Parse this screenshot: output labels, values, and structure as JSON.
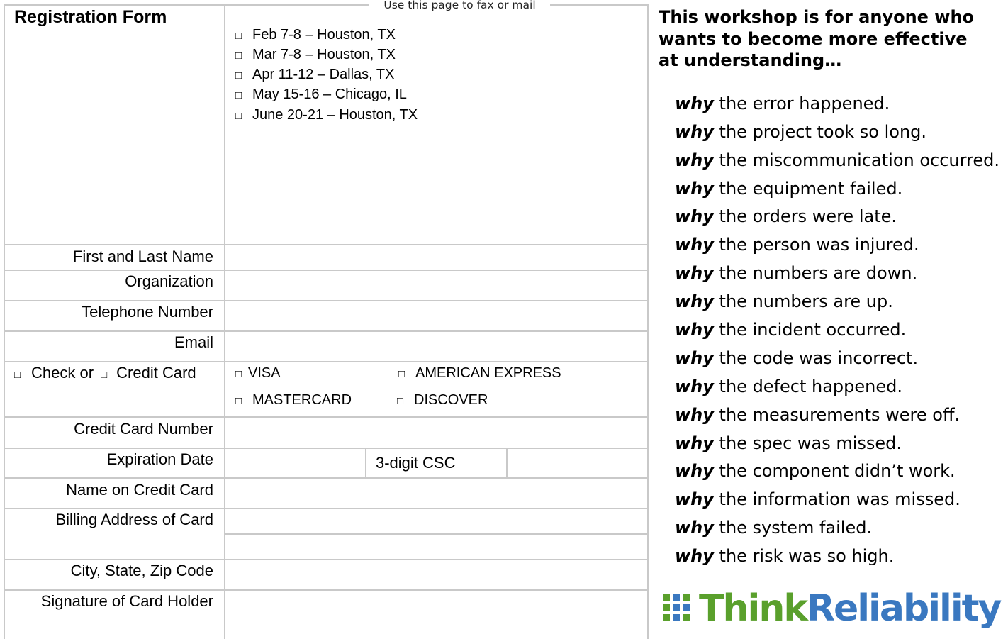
{
  "form": {
    "title": "Registration Form",
    "fax_note": "Use this page to fax or mail",
    "checkbox_glyph": "□",
    "sessions": [
      "Feb 7-8 – Houston, TX",
      "Mar 7-8 – Houston, TX",
      "Apr 11-12 – Dallas, TX",
      "May 15-16 – Chicago, IL",
      "June 20-21 – Houston, TX"
    ],
    "labels": {
      "name": "First and Last Name",
      "organization": "Organization",
      "telephone": "Telephone Number",
      "email": "Email",
      "check": "Check or",
      "credit_card": "Credit Card",
      "card_number": "Credit Card Number",
      "expiration": "Expiration Date",
      "csc": "3-digit CSC",
      "name_on_card": "Name on Credit Card",
      "billing_address": "Billing Address of Card",
      "city_state_zip": "City, State, Zip Code",
      "signature": "Signature of Card Holder"
    },
    "card_types": [
      "VISA",
      "AMERICAN EXPRESS",
      "MASTERCARD",
      "DISCOVER"
    ]
  },
  "workshop": {
    "heading": "This workshop is for anyone who wants to become more effective at understanding…",
    "keyword": "why",
    "reasons": [
      "the error happened.",
      "the project took so long.",
      "the miscommunication occurred.",
      "the equipment failed.",
      "the orders were late.",
      "the person was injured.",
      "the numbers are down.",
      "the numbers are up.",
      "the incident occurred.",
      "the code was incorrect.",
      "the defect happened.",
      "the measurements were off.",
      "the spec was missed.",
      "the component didn’t work.",
      "the information was missed.",
      "the system failed.",
      "the risk was so high."
    ]
  },
  "logo": {
    "think": "Think",
    "reliability": "Reliability",
    "green": "#5aa02c",
    "blue": "#3a78c0"
  }
}
